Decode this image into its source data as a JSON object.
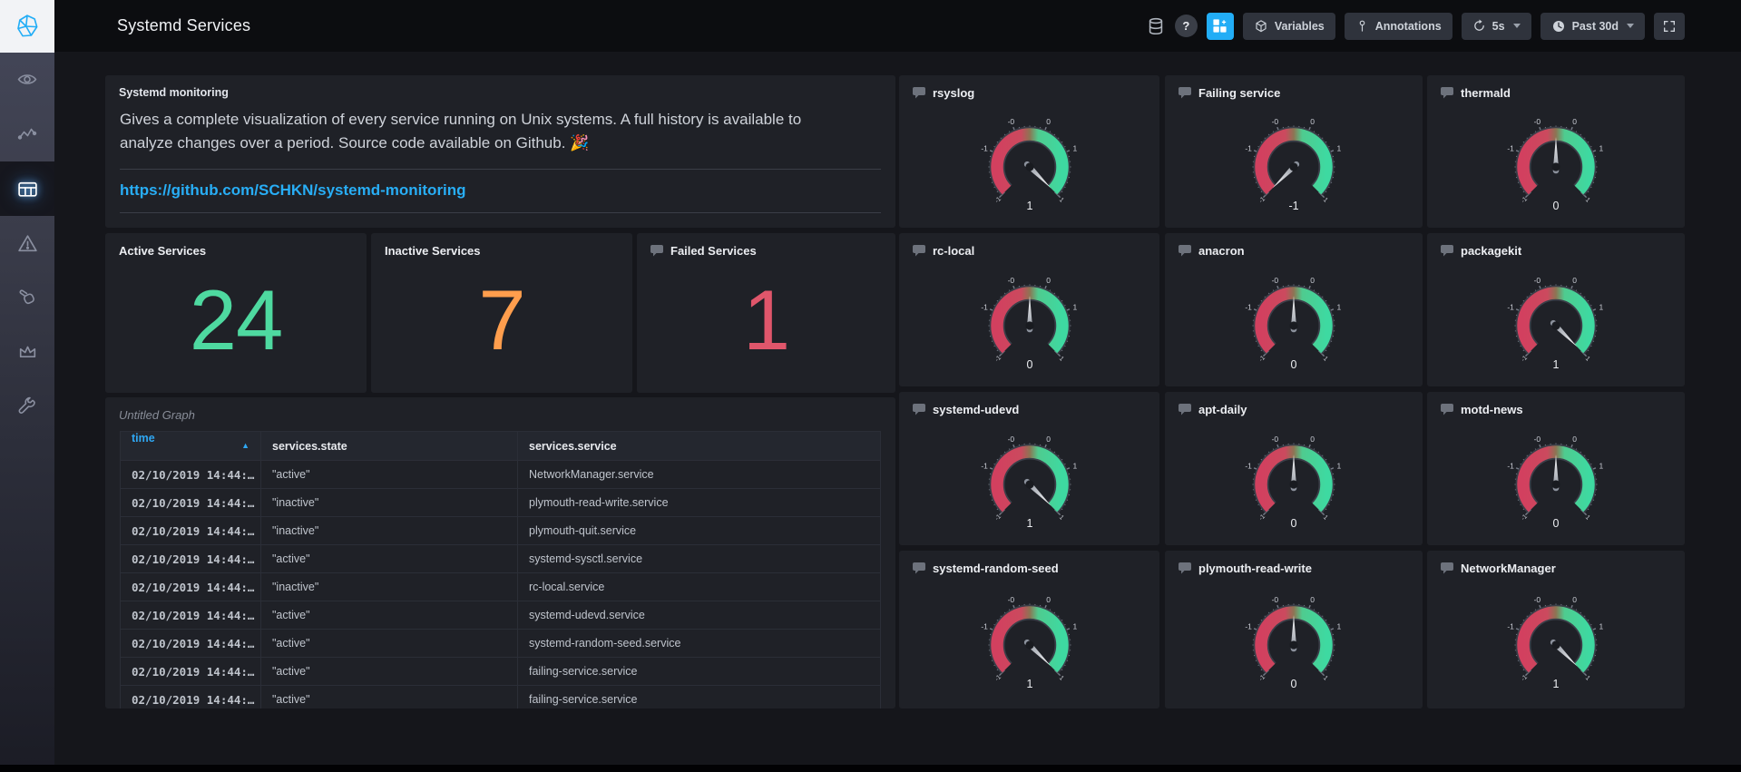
{
  "header": {
    "title": "Systemd Services",
    "variables_label": "Variables",
    "annotations_label": "Annotations",
    "refresh_interval": "5s",
    "time_range": "Past 30d",
    "help_glyph": "?",
    "icons": [
      "database-icon",
      "help-icon",
      "add-cell-icon",
      "cube-icon",
      "annotation-pin-icon",
      "refresh-icon",
      "clock-icon",
      "caret-down-icon",
      "fullscreen-icon"
    ]
  },
  "sidebar": {
    "logo_icon": "chronograf-logo",
    "items": [
      {
        "id": "status",
        "icon": "eye-icon",
        "active": false
      },
      {
        "id": "data-explorer",
        "icon": "graph-pulse-icon",
        "active": false
      },
      {
        "id": "dashboards",
        "icon": "dashboards-grid-icon",
        "active": true
      },
      {
        "id": "alerting",
        "icon": "alert-triangle-icon",
        "active": false
      },
      {
        "id": "log-viewer",
        "icon": "hand-icon",
        "active": false
      },
      {
        "id": "admin",
        "icon": "crown-icon",
        "active": false
      },
      {
        "id": "configuration",
        "icon": "wrench-icon",
        "active": false
      }
    ]
  },
  "panels": {
    "text_panel": {
      "title": "Systemd monitoring",
      "body": "Gives a complete visualization of every service running on Unix systems. A full history is available to analyze changes over a period. Source code available on Github. 🎉",
      "link": "https://github.com/SCHKN/systemd-monitoring"
    },
    "stats": [
      {
        "title": "Active Services",
        "value": "24",
        "color": "#4ed9a0",
        "comment_icon": false
      },
      {
        "title": "Inactive Services",
        "value": "7",
        "color": "#ff9e4d",
        "comment_icon": false
      },
      {
        "title": "Failed Services",
        "value": "1",
        "color": "#e0566b",
        "comment_icon": true
      }
    ],
    "table_panel": {
      "title": "Untitled Graph",
      "sort_indicator": "▲",
      "columns": [
        "time",
        "services.state",
        "services.service"
      ],
      "rows": [
        [
          "02/10/2019 14:44:…",
          "\"active\"",
          "NetworkManager.service"
        ],
        [
          "02/10/2019 14:44:…",
          "\"inactive\"",
          "plymouth-read-write.service"
        ],
        [
          "02/10/2019 14:44:…",
          "\"inactive\"",
          "plymouth-quit.service"
        ],
        [
          "02/10/2019 14:44:…",
          "\"active\"",
          "systemd-sysctl.service"
        ],
        [
          "02/10/2019 14:44:…",
          "\"inactive\"",
          "rc-local.service"
        ],
        [
          "02/10/2019 14:44:…",
          "\"active\"",
          "systemd-udevd.service"
        ],
        [
          "02/10/2019 14:44:…",
          "\"active\"",
          "systemd-random-seed.service"
        ],
        [
          "02/10/2019 14:44:…",
          "\"active\"",
          "failing-service.service"
        ],
        [
          "02/10/2019 14:44:…",
          "\"active\"",
          "failing-service.service"
        ]
      ]
    },
    "gauge_scale": {
      "min": -1,
      "max": 1,
      "tick_labels": [
        {
          "text": "-1",
          "angle": 225,
          "end": true
        },
        {
          "text": "-1",
          "angle": 157.5
        },
        {
          "text": "-0",
          "angle": 112.5
        },
        {
          "text": "0",
          "angle": 67.5
        },
        {
          "text": "1",
          "angle": 22.5
        },
        {
          "text": "1",
          "angle": -45,
          "end": true
        }
      ]
    },
    "gauges": [
      {
        "title": "rsyslog",
        "value": 1
      },
      {
        "title": "Failing service",
        "value": -1
      },
      {
        "title": "thermald",
        "value": 0
      },
      {
        "title": "rc-local",
        "value": 0
      },
      {
        "title": "anacron",
        "value": 0
      },
      {
        "title": "packagekit",
        "value": 1
      },
      {
        "title": "systemd-udevd",
        "value": 1
      },
      {
        "title": "apt-daily",
        "value": 0
      },
      {
        "title": "motd-news",
        "value": 0
      },
      {
        "title": "systemd-random-seed",
        "value": 1
      },
      {
        "title": "plymouth-read-write",
        "value": 0
      },
      {
        "title": "NetworkManager",
        "value": 1
      }
    ]
  },
  "colors": {
    "accent_blue": "#22adf6",
    "stat_green": "#4ed9a0",
    "stat_orange": "#ff9e4d",
    "stat_red": "#e0566b",
    "gauge_red": "#d2405f",
    "gauge_green": "#3ed9a1"
  },
  "chart_data": [
    {
      "type": "gauge",
      "title": "rsyslog",
      "value": 1,
      "range": [
        -1,
        1
      ]
    },
    {
      "type": "gauge",
      "title": "Failing service",
      "value": -1,
      "range": [
        -1,
        1
      ]
    },
    {
      "type": "gauge",
      "title": "thermald",
      "value": 0,
      "range": [
        -1,
        1
      ]
    },
    {
      "type": "gauge",
      "title": "rc-local",
      "value": 0,
      "range": [
        -1,
        1
      ]
    },
    {
      "type": "gauge",
      "title": "anacron",
      "value": 0,
      "range": [
        -1,
        1
      ]
    },
    {
      "type": "gauge",
      "title": "packagekit",
      "value": 1,
      "range": [
        -1,
        1
      ]
    },
    {
      "type": "gauge",
      "title": "systemd-udevd",
      "value": 1,
      "range": [
        -1,
        1
      ]
    },
    {
      "type": "gauge",
      "title": "apt-daily",
      "value": 0,
      "range": [
        -1,
        1
      ]
    },
    {
      "type": "gauge",
      "title": "motd-news",
      "value": 0,
      "range": [
        -1,
        1
      ]
    },
    {
      "type": "gauge",
      "title": "systemd-random-seed",
      "value": 1,
      "range": [
        -1,
        1
      ]
    },
    {
      "type": "gauge",
      "title": "plymouth-read-write",
      "value": 0,
      "range": [
        -1,
        1
      ]
    },
    {
      "type": "gauge",
      "title": "NetworkManager",
      "value": 1,
      "range": [
        -1,
        1
      ]
    }
  ]
}
